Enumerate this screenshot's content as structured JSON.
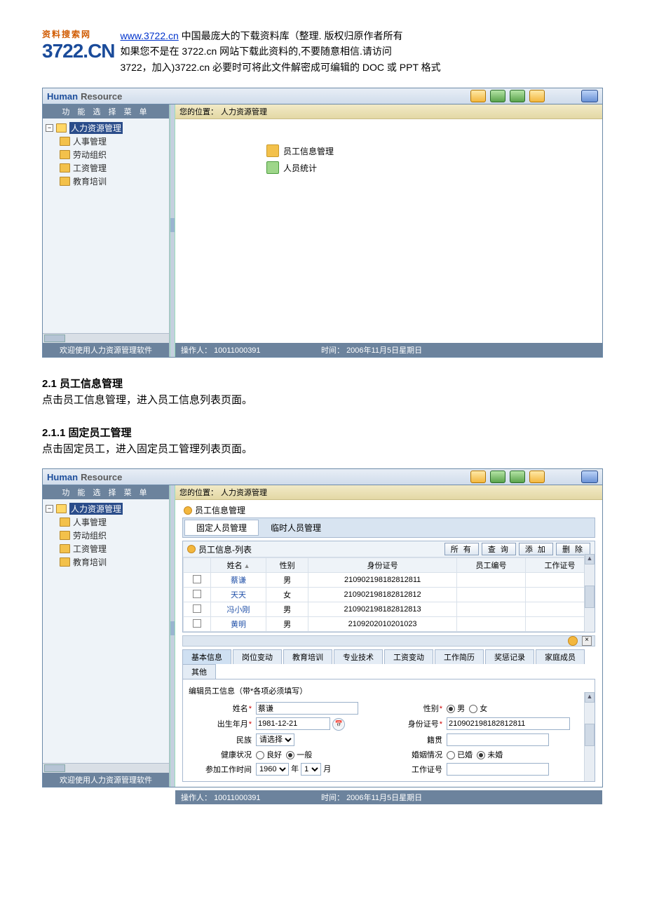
{
  "header": {
    "logo_top": "资料搜索网",
    "logo_main": "3722.CN",
    "link": "www.3722.cn",
    "line1_rest": " 中国最庞大的下载资料库（整理. 版权归原作者所有",
    "line2": "如果您不是在 3722.cn 网站下载此资料的,不要随意相信.请访问",
    "line3": "3722，加入)3722.cn 必要时可将此文件解密成可编辑的 DOC 或 PPT 格式"
  },
  "app": {
    "brand_h": "Human",
    "brand_r": "Resource",
    "sidebar_title": "功 能 选 择 菜 单",
    "tree_root": "人力资源管理",
    "tree_items": {
      "a": "人事管理",
      "b": "劳动组织",
      "c": "工资管理",
      "d": "教育培训"
    },
    "sidebar_footer": "欢迎使用人力资源管理软件",
    "crumb_prefix": "您的位置：",
    "crumb_value": "人力资源管理",
    "content_links": {
      "a": "员工信息管理",
      "b": "人员统计"
    },
    "footer_operator_label": "操作人：",
    "footer_operator": "10011000391",
    "footer_time_label": "时间：",
    "footer_time": "2006年11月5日星期日"
  },
  "doc": {
    "h2_1": "2.1 员工信息管理",
    "p_1": "点击员工信息管理，进入员工信息列表页面。",
    "h2_2": "2.1.1 固定员工管理",
    "p_2": "点击固定员工，进入固定员工管理列表页面。"
  },
  "app2": {
    "sub_title": "员工信息管理",
    "tab_fixed": "固定人员管理",
    "tab_temp": "临时人员管理",
    "list_title": "员工信息-列表",
    "btn_all": "所 有",
    "btn_query": "查 询",
    "btn_add": "添 加",
    "btn_del": "删 除",
    "th_name": "姓名",
    "th_sex": "性别",
    "th_id": "身份证号",
    "th_emp": "员工编号",
    "th_work": "工作证号",
    "rows": [
      {
        "name": "蔡谦",
        "sex": "男",
        "id": "210902198182812811"
      },
      {
        "name": "天天",
        "sex": "女",
        "id": "210902198182812812"
      },
      {
        "name": "冯小刚",
        "sex": "男",
        "id": "210902198182812813"
      },
      {
        "name": "黄明",
        "sex": "男",
        "id": "2109202010201023"
      }
    ],
    "subtabs": {
      "a": "基本信息",
      "b": "岗位变动",
      "c": "教育培训",
      "d": "专业技术",
      "e": "工资变动",
      "f": "工作简历",
      "g": "奖惩记录",
      "h": "家庭成员",
      "i": "其他"
    },
    "form_title": "编辑员工信息（带*各项必须填写）",
    "labels": {
      "name": "姓名",
      "sex": "性别",
      "birth": "出生年月",
      "id": "身份证号",
      "nation": "民族",
      "native": "籍贯",
      "health": "健康状况",
      "marriage": "婚姻情况",
      "workstart": "参加工作时间",
      "workno": "工作证号"
    },
    "values": {
      "name": "蔡谦",
      "sex_male": "男",
      "sex_female": "女",
      "birth": "1981-12-21",
      "id": "210902198182812811",
      "nation_ph": "请选择",
      "health_good": "良好",
      "health_normal": "一般",
      "marriage_yes": "已婚",
      "marriage_no": "未婚",
      "work_year": "1960",
      "work_year_unit": "年",
      "work_month": "1",
      "work_month_unit": "月"
    }
  }
}
